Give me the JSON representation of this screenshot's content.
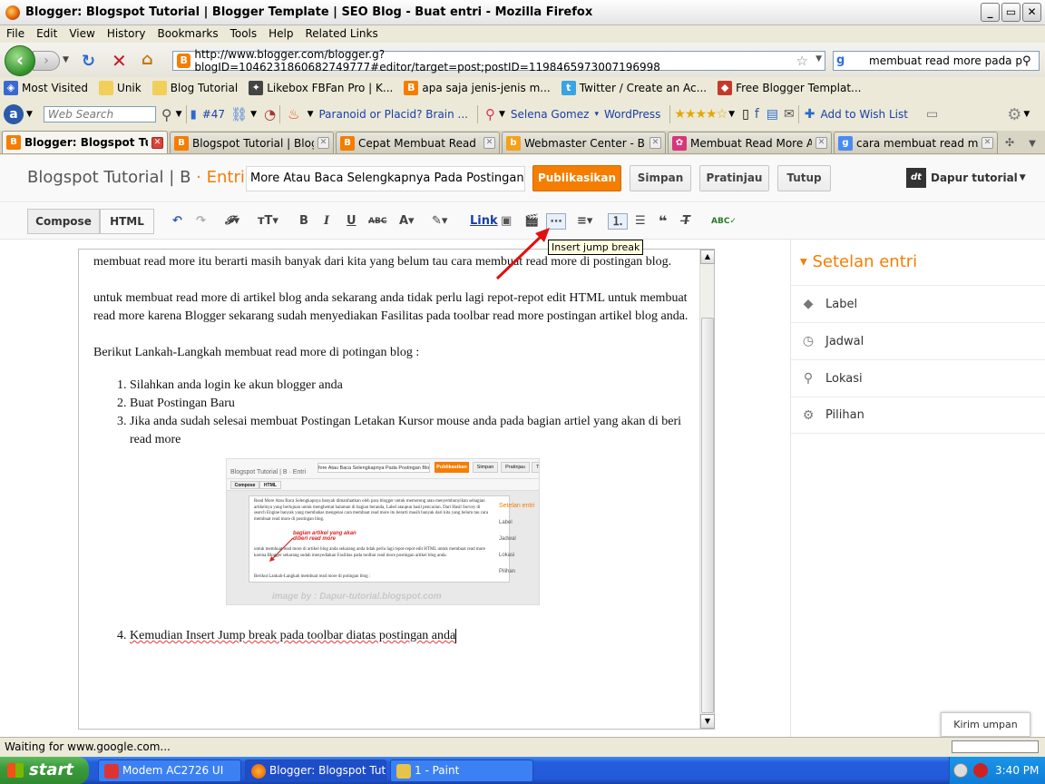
{
  "window": {
    "title": "Blogger: Blogspot Tutorial | Blogger Template | SEO Blog - Buat entri - Mozilla Firefox",
    "min": "_",
    "max": "▭",
    "close": "✕"
  },
  "menu": [
    "File",
    "Edit",
    "View",
    "History",
    "Bookmarks",
    "Tools",
    "Help",
    "Related Links"
  ],
  "nav": {
    "url": "http://www.blogger.com/blogger.g?blogID=1046231860682749777#editor/target=post;postID=1198465973007196998",
    "search_value": "membuat read more pada postingan"
  },
  "bookmarks": [
    "Most Visited",
    "Unik",
    "Blog Tutorial",
    "Likebox FBFan Pro | K...",
    "apa saja jenis-jenis m...",
    "Twitter / Create an Ac...",
    "Free Blogger Templat..."
  ],
  "addon": {
    "websearch_placeholder": "Web Search",
    "count": "#47",
    "paranoid": "Paranoid or Placid? Brain ...",
    "selena": "Selena Gomez",
    "wordpress": "WordPress",
    "wishlist": "Add to Wish List"
  },
  "tabs": [
    {
      "label": "Blogger: Blogspot Tut...",
      "active": true,
      "color": "#f57d00"
    },
    {
      "label": "Blogspot Tutorial | Blogge...",
      "active": false,
      "color": "#f57d00"
    },
    {
      "label": "Cepat Membuat Read Mo...",
      "active": false,
      "color": "#f57d00"
    },
    {
      "label": "Webmaster Center - Bing",
      "active": false,
      "color": "#f3a21a"
    },
    {
      "label": "Membuat Read More Ata...",
      "active": false,
      "color": "#d8357a"
    },
    {
      "label": "cara membuat read more...",
      "active": false,
      "color": "#4a8af4"
    }
  ],
  "blogger": {
    "blog_name": "Blogspot Tutorial | B",
    "section": "· Entri",
    "post_title": "More Atau Baca Selengkapnya Pada Postingan Blog",
    "publish": "Publikasikan",
    "save": "Simpan",
    "preview": "Pratinjau",
    "close": "Tutup",
    "user": "Dapur tutorial",
    "compose": "Compose",
    "html": "HTML",
    "link": "Link",
    "tooltip": "Insert jump break"
  },
  "editor": {
    "p1": "membuat read more itu berarti masih banyak dari kita yang belum tau cara membuat read more di postingan blog.",
    "p2": "untuk membuat read more di artikel blog anda sekarang anda tidak perlu lagi repot-repot edit HTML untuk membuat read more karena Blogger sekarang sudah menyediakan Fasilitas pada toolbar read more postingan artikel blog anda.",
    "p3": "Berikut Lankah-Langkah membuat read more di potingan blog :",
    "steps": [
      "Silahkan anda login ke akun blogger anda",
      "Buat Postingan Baru",
      "Jika anda sudah selesai membuat Postingan Letakan Kursor mouse anda pada bagian artiel yang akan di beri read more"
    ],
    "step4": "Kemudian Insert Jump break pada toolbar diatas postingan anda",
    "embed": {
      "blog_name": "Blogspot Tutorial | B · Entri",
      "title": "fore Atau Baca Selengkapnya Pada Postingan Blog",
      "publish": "Publikasikan",
      "save": "Simpan",
      "preview": "Pratinjau",
      "close": "Tutup",
      "compose": "Compose",
      "html": "HTML",
      "text1": "Read More Atau Baca Selengkapnya banyak dimanfaatkan oleh para blogger untuk memotong atau menyembunyikan sebagian artikelnya yang bertujuan untuk menghemat halaman di bagian beranda, Label ataupun hasil pencarian. Dari Hasil Survey di search Engine banyak yang membahas mengenai cara membuat read more itu berarti masih banyak dari kita yang belum tau cara membuat read more di postingan blog.",
      "annot": "bagian artikel yang akan diberi read more",
      "text2": "untuk membuat read more di artikel blog anda sekarang anda tidak perlu lagi repot-repot edit HTML untuk membuat read more karena Blogger sekarang sudah menyediakan Fasilitas pada toolbar read more postingan artikel blog anda.",
      "text3": "Berikut Lankah-Langkah membuat read more di potingan blog :",
      "watermark": "image by : Dapur-tutorial.blogspot.com",
      "side_title": "Setelan entri",
      "side_items": [
        "Label",
        "Jadwal",
        "Lokasi",
        "Pilihan"
      ]
    }
  },
  "sidebar": {
    "title": "Setelan entri",
    "items": [
      "Label",
      "Jadwal",
      "Lokasi",
      "Pilihan"
    ]
  },
  "feedback": "Kirim umpan balik",
  "status": "Waiting for www.google.com...",
  "taskbar": {
    "start": "start",
    "tasks": [
      "Modem AC2726 UI",
      "Blogger: Blogspot Tuto...",
      "1 - Paint"
    ],
    "clock": "3:40 PM"
  }
}
